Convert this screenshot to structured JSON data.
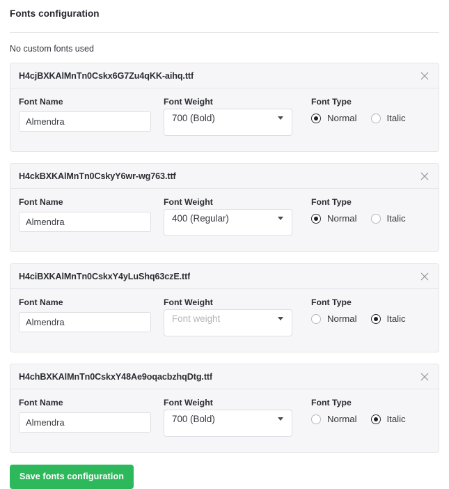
{
  "panel": {
    "title": "Fonts configuration",
    "note": "No custom fonts used"
  },
  "labels": {
    "font_name": "Font Name",
    "font_weight": "Font Weight",
    "font_type": "Font Type",
    "normal": "Normal",
    "italic": "Italic",
    "weight_placeholder": "Font weight",
    "remove_icon": "close-icon"
  },
  "colors": {
    "accent_green": "#2eb85c",
    "card_bg": "#f6f6f8",
    "card_border": "#e6e6ea",
    "input_border": "#dfdfe4",
    "select_border": "#dcdce5",
    "text": "#2b2d34",
    "placeholder": "#b5b5bb"
  },
  "fonts": [
    {
      "filename": "H4cjBXKAlMnTn0Cskx6G7Zu4qKK-aihq.ttf",
      "name_value": "Almendra",
      "weight_value": "700 (Bold)",
      "weight_is_placeholder": false,
      "type_selected": "Normal"
    },
    {
      "filename": "H4ckBXKAlMnTn0CskyY6wr-wg763.ttf",
      "name_value": "Almendra",
      "weight_value": "400 (Regular)",
      "weight_is_placeholder": false,
      "type_selected": "Normal"
    },
    {
      "filename": "H4ciBXKAlMnTn0CskxY4yLuShq63czE.ttf",
      "name_value": "Almendra",
      "weight_value": "Font weight",
      "weight_is_placeholder": true,
      "type_selected": "Italic"
    },
    {
      "filename": "H4chBXKAlMnTn0CskxY48Ae9oqacbzhqDtg.ttf",
      "name_value": "Almendra",
      "weight_value": "700 (Bold)",
      "weight_is_placeholder": false,
      "type_selected": "Italic"
    }
  ],
  "save": {
    "label": "Save fonts configuration"
  }
}
